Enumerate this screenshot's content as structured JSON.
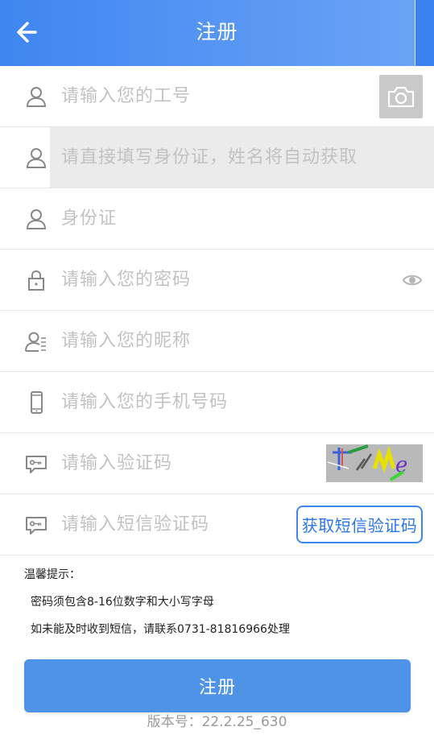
{
  "header": {
    "title": "注册",
    "background_color": "#4a8ef1"
  },
  "form": {
    "employee_id": {
      "placeholder": "请输入您的工号",
      "value": ""
    },
    "id_card_name": {
      "placeholder": "请直接填写身份证，姓名将自动获取",
      "value": ""
    },
    "id_card": {
      "placeholder": "身份证",
      "value": ""
    },
    "password": {
      "placeholder": "请输入您的密码",
      "value": ""
    },
    "nickname": {
      "placeholder": "请输入您的昵称",
      "value": ""
    },
    "phone": {
      "placeholder": "请输入您的手机号码",
      "value": ""
    },
    "captcha": {
      "placeholder": "请输入验证码",
      "value": ""
    },
    "sms_code": {
      "placeholder": "请输入短信验证码",
      "value": ""
    },
    "sms_button_label": "获取短信验证码"
  },
  "icons": {
    "back": "arrow-left-icon",
    "camera": "camera-icon",
    "user": "user-icon",
    "lock": "lock-icon",
    "eye": "eye-icon",
    "nickname": "user-card-icon",
    "phone": "phone-icon",
    "captcha": "message-key-icon"
  },
  "tips": {
    "title": "温馨提示：",
    "lines": [
      "密码须包含8-16位数字和大小写字母",
      "如未能及时收到短信，请联系0731-81816966处理"
    ]
  },
  "register_button_label": "注册",
  "version_text": "版本号：22.2.25_630",
  "colors": {
    "accent": "#4f93e6",
    "placeholder": "#c2c2c2",
    "divider": "#e6e6e6",
    "disabled_field": "#ebebeb"
  }
}
